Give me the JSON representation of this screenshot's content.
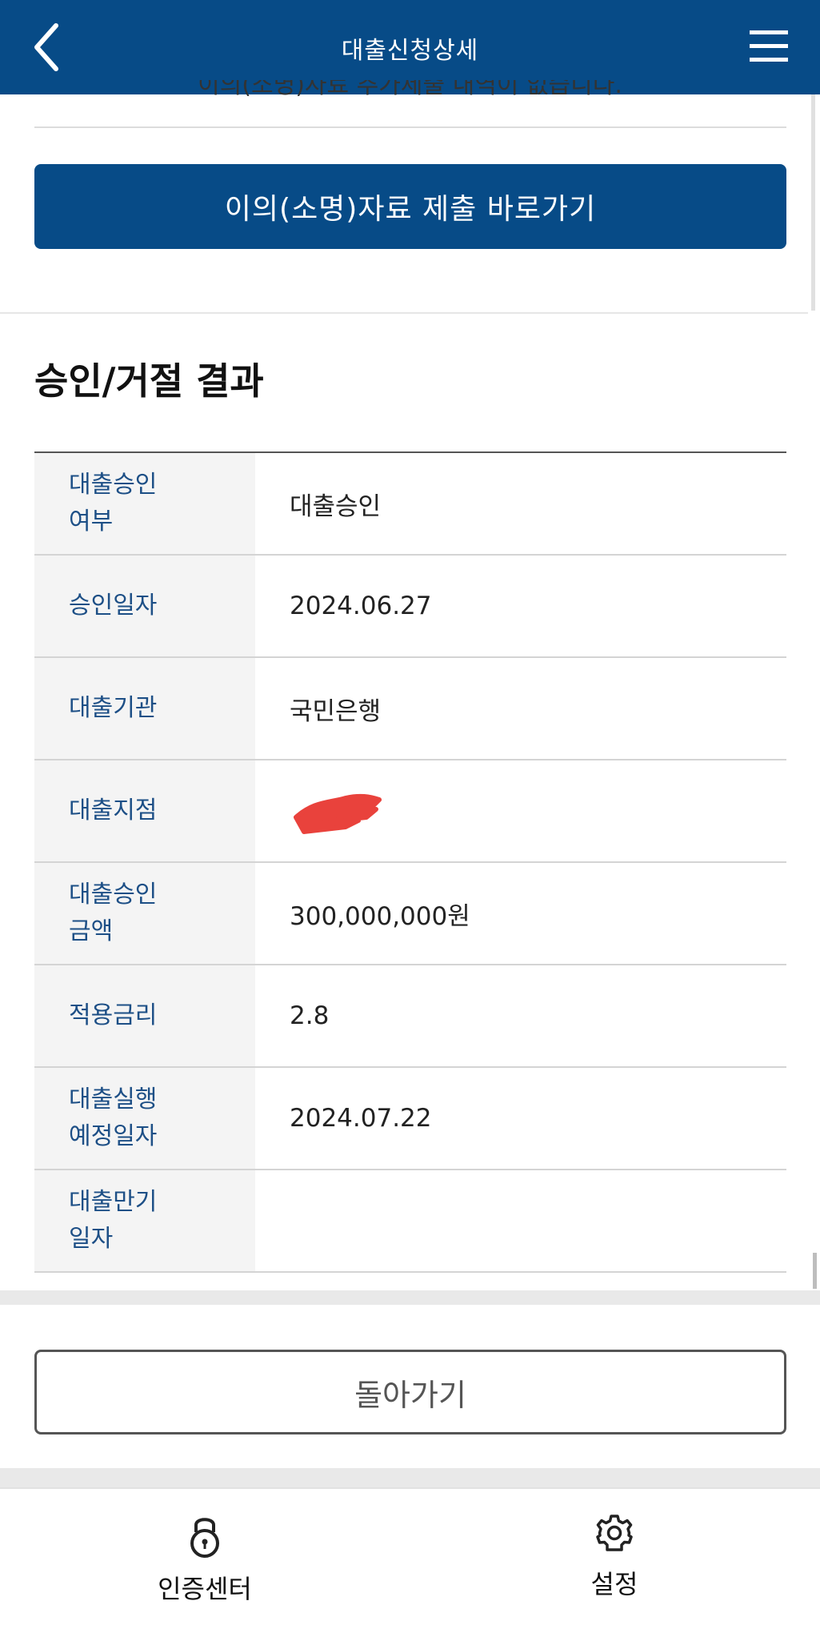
{
  "header": {
    "title": "대출신청상세",
    "back_icon": "chevron-left-icon",
    "menu_icon": "hamburger-menu-icon"
  },
  "notice": {
    "text": "이의(소명)자료 추가제출 내역이 없습니다."
  },
  "objection_button": {
    "label": "이의(소명)자료 제출  바로가기"
  },
  "result_section": {
    "title": "승인/거절 결과",
    "rows": [
      {
        "label": "대출승인\n여부",
        "value": "대출승인"
      },
      {
        "label": "승인일자",
        "value": "2024.06.27"
      },
      {
        "label": "대출기관",
        "value": "국민은행"
      },
      {
        "label": "대출지점",
        "value": ""
      },
      {
        "label": "대출승인\n금액",
        "value": "300,000,000원"
      },
      {
        "label": "적용금리",
        "value": "2.8"
      },
      {
        "label": "대출실행\n예정일자",
        "value": "2024.07.22"
      },
      {
        "label": "대출만기\n일자",
        "value": ""
      }
    ]
  },
  "back_button": {
    "label": "돌아가기"
  },
  "bottom_nav": {
    "items": [
      {
        "label": "인증센터",
        "icon": "lock-icon"
      },
      {
        "label": "설정",
        "icon": "gear-icon"
      }
    ]
  },
  "colors": {
    "brand": "#074b87",
    "label_text": "#1d4f86",
    "redaction": "#e8322c"
  }
}
